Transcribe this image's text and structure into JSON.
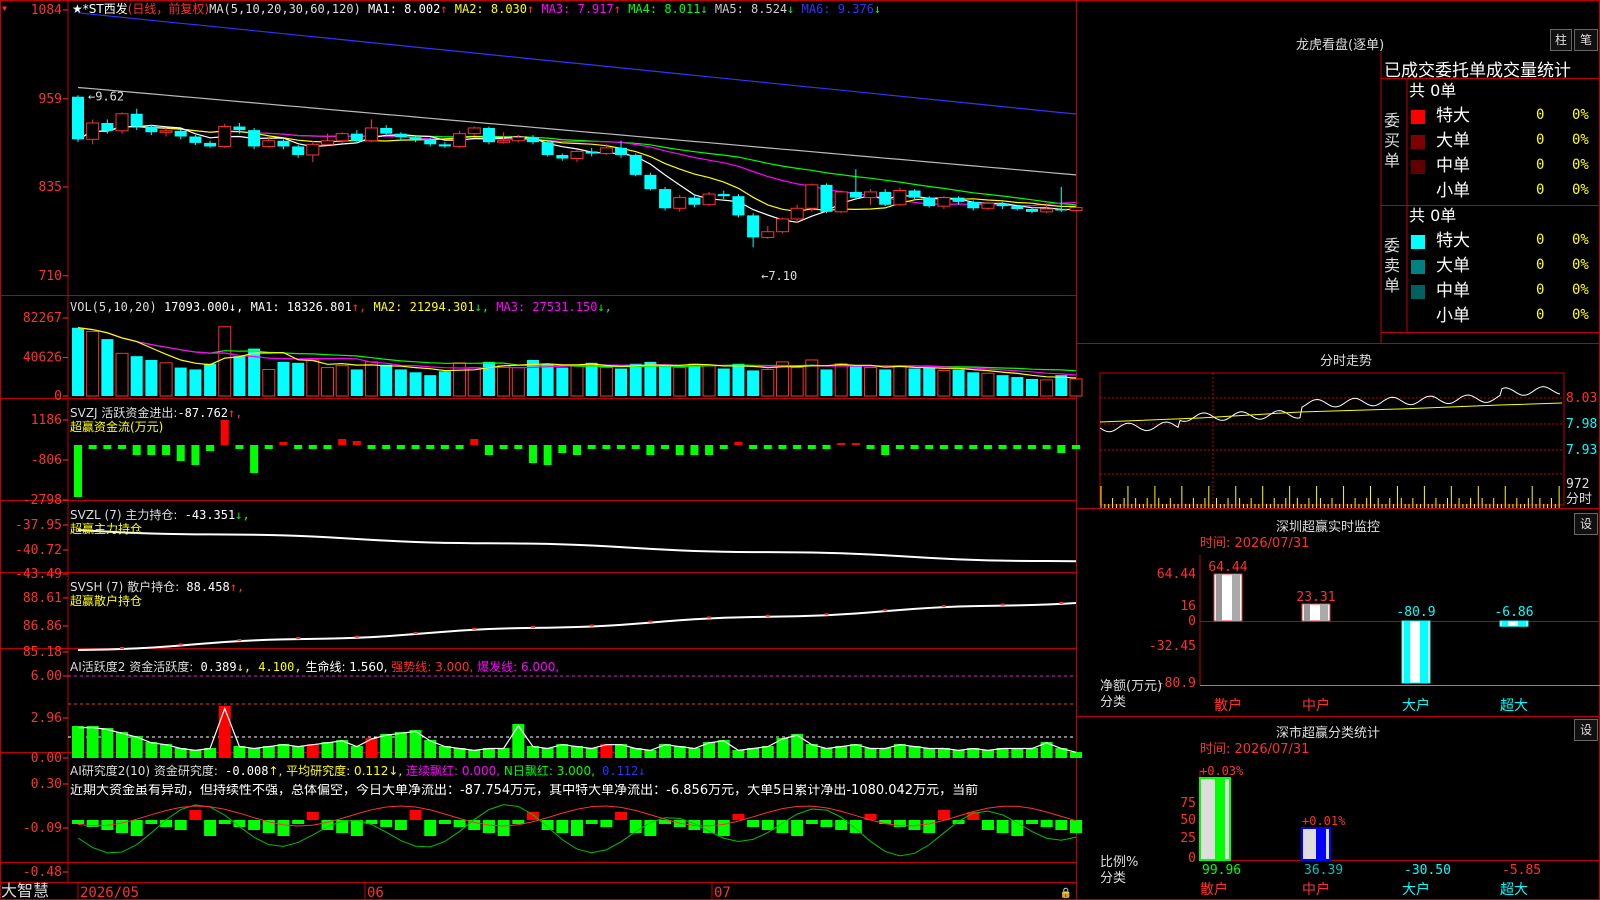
{
  "app": {
    "brand": "大智慧",
    "lock_icon": "lock-icon"
  },
  "colors": {
    "up": "#ff3030",
    "down": "#00ffff",
    "ma1": "#ffffff",
    "ma2": "#ffff00",
    "ma3": "#ff00ff",
    "ma4": "#00ff00",
    "ma5": "#aaaaaa",
    "ma6": "#3333ff",
    "border": "#c00000"
  },
  "kline": {
    "title_stock": "★*ST西发",
    "period": "(日线，前复权)",
    "ma_label": "MA(5,10,20,30,60,120)",
    "ma": [
      {
        "name": "MA1:",
        "value": "8.002",
        "arrow": "↑",
        "color": "#ffffff"
      },
      {
        "name": "MA2:",
        "value": "8.030",
        "arrow": "↑",
        "color": "#ffff00"
      },
      {
        "name": "MA3:",
        "value": "7.917",
        "arrow": "↑",
        "color": "#ff00ff"
      },
      {
        "name": "MA4:",
        "value": "8.011",
        "arrow": "↓",
        "color": "#00ff00"
      },
      {
        "name": "MA5:",
        "value": "8.524",
        "arrow": "↓",
        "color": "#cccccc"
      },
      {
        "name": "MA6:",
        "value": "9.376",
        "arrow": "↓",
        "color": "#3333ff"
      }
    ],
    "y_ticks": [
      "1084",
      "959",
      "835",
      "710"
    ],
    "high_mark": "←9.62",
    "low_mark": "←7.10",
    "candles": [
      [
        9.62,
        9.02,
        9.64,
        8.98
      ],
      [
        9.02,
        9.25,
        9.3,
        8.95
      ],
      [
        9.25,
        9.14,
        9.3,
        9.1
      ],
      [
        9.14,
        9.38,
        9.4,
        9.1
      ],
      [
        9.38,
        9.2,
        9.45,
        9.15
      ],
      [
        9.2,
        9.12,
        9.22,
        9.08
      ],
      [
        9.12,
        9.14,
        9.18,
        9.06
      ],
      [
        9.14,
        9.06,
        9.16,
        9.02
      ],
      [
        9.06,
        8.97,
        9.08,
        8.94
      ],
      [
        8.97,
        8.92,
        9.0,
        8.9
      ],
      [
        8.92,
        9.2,
        9.24,
        8.9
      ],
      [
        9.2,
        9.15,
        9.25,
        9.1
      ],
      [
        9.15,
        8.92,
        9.18,
        8.88
      ],
      [
        8.92,
        9.0,
        9.04,
        8.9
      ],
      [
        9.0,
        8.92,
        9.02,
        8.88
      ],
      [
        8.92,
        8.8,
        8.94,
        8.76
      ],
      [
        8.8,
        8.95,
        9.0,
        8.7
      ],
      [
        8.95,
        9.0,
        9.1,
        8.94
      ],
      [
        9.0,
        9.1,
        9.12,
        8.96
      ],
      [
        9.1,
        9.0,
        9.15,
        8.96
      ],
      [
        9.0,
        9.18,
        9.3,
        8.98
      ],
      [
        9.18,
        9.1,
        9.22,
        9.06
      ],
      [
        9.1,
        9.05,
        9.12,
        9.0
      ],
      [
        9.05,
        9.02,
        9.08,
        8.98
      ],
      [
        9.02,
        8.95,
        9.04,
        8.92
      ],
      [
        8.95,
        8.92,
        8.98,
        8.9
      ],
      [
        8.92,
        9.1,
        9.14,
        8.9
      ],
      [
        9.1,
        9.18,
        9.2,
        9.08
      ],
      [
        9.18,
        8.98,
        9.2,
        8.95
      ],
      [
        8.98,
        9.0,
        9.12,
        8.96
      ],
      [
        9.0,
        9.05,
        9.08,
        8.98
      ],
      [
        9.05,
        8.98,
        9.08,
        8.95
      ],
      [
        8.98,
        8.8,
        9.0,
        8.78
      ],
      [
        8.8,
        8.75,
        8.82,
        8.72
      ],
      [
        8.75,
        8.85,
        8.88,
        8.7
      ],
      [
        8.85,
        8.82,
        8.9,
        8.78
      ],
      [
        8.82,
        8.9,
        8.95,
        8.8
      ],
      [
        8.9,
        8.8,
        9.0,
        8.76
      ],
      [
        8.8,
        8.52,
        8.82,
        8.5
      ],
      [
        8.52,
        8.32,
        8.55,
        8.3
      ],
      [
        8.32,
        8.05,
        8.35,
        8.02
      ],
      [
        8.05,
        8.2,
        8.24,
        8.0
      ],
      [
        8.2,
        8.1,
        8.25,
        8.06
      ],
      [
        8.1,
        8.25,
        8.28,
        8.08
      ],
      [
        8.25,
        8.22,
        8.3,
        8.18
      ],
      [
        8.22,
        7.95,
        8.25,
        7.92
      ],
      [
        7.95,
        7.64,
        7.98,
        7.5
      ],
      [
        7.64,
        7.72,
        7.8,
        7.62
      ],
      [
        7.72,
        7.9,
        7.92,
        7.7
      ],
      [
        7.9,
        8.05,
        8.1,
        7.85
      ],
      [
        8.05,
        8.38,
        8.4,
        8.0
      ],
      [
        8.38,
        8.0,
        8.4,
        7.98
      ],
      [
        8.0,
        8.28,
        8.3,
        7.98
      ],
      [
        8.28,
        8.2,
        8.6,
        8.18
      ],
      [
        8.2,
        8.28,
        8.32,
        8.1
      ],
      [
        8.28,
        8.1,
        8.32,
        8.08
      ],
      [
        8.1,
        8.3,
        8.34,
        8.08
      ],
      [
        8.3,
        8.2,
        8.32,
        8.16
      ],
      [
        8.2,
        8.08,
        8.22,
        8.06
      ],
      [
        8.08,
        8.2,
        8.22,
        8.04
      ],
      [
        8.2,
        8.14,
        8.22,
        8.1
      ],
      [
        8.14,
        8.05,
        8.16,
        8.02
      ],
      [
        8.05,
        8.12,
        8.14,
        8.02
      ],
      [
        8.12,
        8.08,
        8.14,
        8.04
      ],
      [
        8.08,
        8.04,
        8.1,
        8.02
      ],
      [
        8.04,
        8.0,
        8.06,
        7.98
      ],
      [
        8.0,
        8.04,
        8.1,
        7.98
      ],
      [
        8.04,
        8.02,
        8.35,
        8.0
      ],
      [
        8.02,
        8.06,
        8.1,
        8.0
      ]
    ]
  },
  "vol": {
    "label": "VOL(5,10,20)",
    "value": "17093.000↓,",
    "ma": [
      {
        "name": "MA1:",
        "value": "18326.801",
        "arrow": "↑",
        "color": "#ffffff"
      },
      {
        "name": "MA2:",
        "value": "21294.301",
        "arrow": "↓",
        "color": "#ffff00"
      },
      {
        "name": "MA3:",
        "value": "27531.150",
        "arrow": "↓",
        "color": "#ff00ff"
      }
    ],
    "y_ticks": [
      "82267",
      "40626",
      "0"
    ],
    "values": [
      72000,
      68000,
      60000,
      45000,
      42000,
      38000,
      35000,
      30000,
      28000,
      34000,
      73000,
      42000,
      50000,
      28000,
      36000,
      35000,
      38000,
      30000,
      32000,
      28000,
      36000,
      33000,
      28000,
      25000,
      22000,
      26000,
      35000,
      30000,
      36000,
      32000,
      30000,
      38000,
      34000,
      30000,
      32000,
      35000,
      30000,
      29000,
      34000,
      36000,
      33000,
      30000,
      34000,
      32000,
      29000,
      34000,
      27000,
      28000,
      36000,
      30000,
      38000,
      28000,
      34000,
      32000,
      30000,
      28000,
      32000,
      29000,
      30000,
      27000,
      28000,
      25000,
      24000,
      22000,
      20000,
      18000,
      17000,
      22000,
      18000
    ]
  },
  "svzj": {
    "label": "SVZJ  活跃资金进出:",
    "value": "-87.762",
    "arrow": "↑,",
    "subtitle": "超赢资金流(万元)",
    "y_ticks": [
      "1186",
      "-806",
      "-2798"
    ]
  },
  "svzl": {
    "label": "SVZL (7) 主力持仓:",
    "value": "-43.351",
    "arrow": "↓,",
    "subtitle": "超赢主力持仓",
    "y_ticks": [
      "-37.95",
      "-40.72",
      "-43.49"
    ]
  },
  "svsh": {
    "label": "SVSH (7) 散户持仓:",
    "value": "88.458",
    "arrow": "↑,",
    "subtitle": "超赢散户持仓",
    "y_ticks": [
      "88.61",
      "86.86",
      "85.18"
    ]
  },
  "ai1": {
    "label": "AI活跃度2 资金活跃度:",
    "value": "0.389",
    "v2": "↓, 4.100,",
    "v3": " 生命线: 1.560,",
    "v4": " 强势线: 3.000,",
    "v5": " 爆发线: 6.000,",
    "y_ticks": [
      "6.00",
      "2.96",
      "0.00"
    ]
  },
  "ai2": {
    "label": "AI研究度2(10) 资金研究度:",
    "value": "-0.008",
    "v2": "↑, 平均研究度: 0.112↓,",
    "v3": " 连续飘红: 0.000,",
    "v4": " N日飘红: 3.000,",
    "v5": " 0.112↓",
    "commentary": "近期大资金虽有异动，但持续性不强，总体偏空，今日大单净流出：-87.754万元，其中特大单净流出：-6.856万元，大单5日累计净出-1080.042万元，当前",
    "y_ticks": [
      "0.30",
      "-0.09",
      "-0.48"
    ]
  },
  "xaxis": {
    "labels": [
      "2026/05",
      "06",
      "07"
    ]
  },
  "longhu": {
    "title": "龙虎看盘(逐单)",
    "btn1": "柱",
    "btn2": "笔",
    "header": "已成交委托单成交量统计",
    "buy_label": "委买单",
    "sell_label": "委卖单",
    "buy_total": "共 0单",
    "sell_total": "共 0单",
    "buy_rows": [
      {
        "name": "特大",
        "count": "0",
        "pct": "0%",
        "color": "#ff0000"
      },
      {
        "name": "大单",
        "count": "0",
        "pct": "0%",
        "color": "#800000"
      },
      {
        "name": "中单",
        "count": "0",
        "pct": "0%",
        "color": "#600000"
      },
      {
        "name": "小单",
        "count": "0",
        "pct": "0%",
        "color": ""
      }
    ],
    "sell_rows": [
      {
        "name": "特大",
        "count": "0",
        "pct": "0%",
        "color": "#00ffff"
      },
      {
        "name": "大单",
        "count": "0",
        "pct": "0%",
        "color": "#008080"
      },
      {
        "name": "中单",
        "count": "0",
        "pct": "0%",
        "color": "#006060"
      },
      {
        "name": "小单",
        "count": "0",
        "pct": "0%",
        "color": ""
      }
    ]
  },
  "intraday": {
    "title": "分时走势",
    "y_ticks": [
      "8.03",
      "7.98",
      "7.93",
      "972",
      "分时"
    ]
  },
  "sz_monitor": {
    "title": "深圳超赢实时监控",
    "btn": "设",
    "time_label": "时间: 2026/07/31",
    "y_ticks": [
      "64.44",
      "16",
      "0",
      "-32.45",
      "-80.9"
    ],
    "ylabel": "净额(万元)",
    "xlabel": "分类",
    "cats": [
      "散户",
      "中户",
      "大户",
      "超大"
    ],
    "values": [
      64.44,
      23.31,
      -80.9,
      -6.86
    ],
    "labels": [
      "64.44",
      "23.31",
      "-80.9",
      "-6.86"
    ]
  },
  "sz_class": {
    "title": "深市超赢分类统计",
    "btn": "设",
    "time_label": "时间: 2026/07/31",
    "y_ticks": [
      "75",
      "50",
      "25",
      "0"
    ],
    "ylabel": "比例%",
    "xlabel": "分类",
    "top_labels": [
      "+0.03%",
      "+0.01%"
    ],
    "values": [
      "99.96",
      "36.39",
      "-30.50",
      "-5.85"
    ],
    "cats": [
      "散户",
      "中户",
      "大户",
      "超大"
    ]
  }
}
